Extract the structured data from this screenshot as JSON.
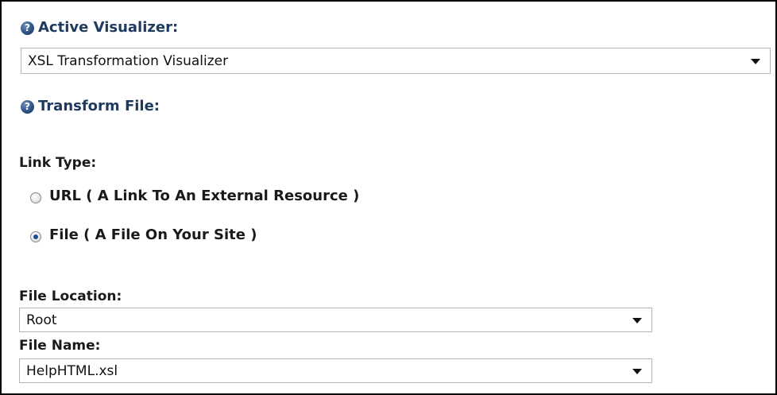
{
  "visualizer": {
    "label": "Active Visualizer:",
    "help_glyph": "?",
    "selected": "XSL Transformation Visualizer"
  },
  "transform": {
    "label": "Transform File:",
    "help_glyph": "?"
  },
  "link_type": {
    "label": "Link Type:",
    "options": [
      {
        "label": "URL ( A Link To An External Resource )",
        "checked": false
      },
      {
        "label": "File ( A File On Your Site )",
        "checked": true
      }
    ]
  },
  "file_location": {
    "label": "File Location:",
    "selected": "Root"
  },
  "file_name": {
    "label": "File Name:",
    "selected": "HelpHTML.xsl"
  },
  "colors": {
    "heading": "#1f3a5f",
    "help_icon": "#2b4f82",
    "radio_dot": "#1f4e8f"
  },
  "icons": [
    "help-icon",
    "radio-button",
    "dropdown-caret"
  ]
}
